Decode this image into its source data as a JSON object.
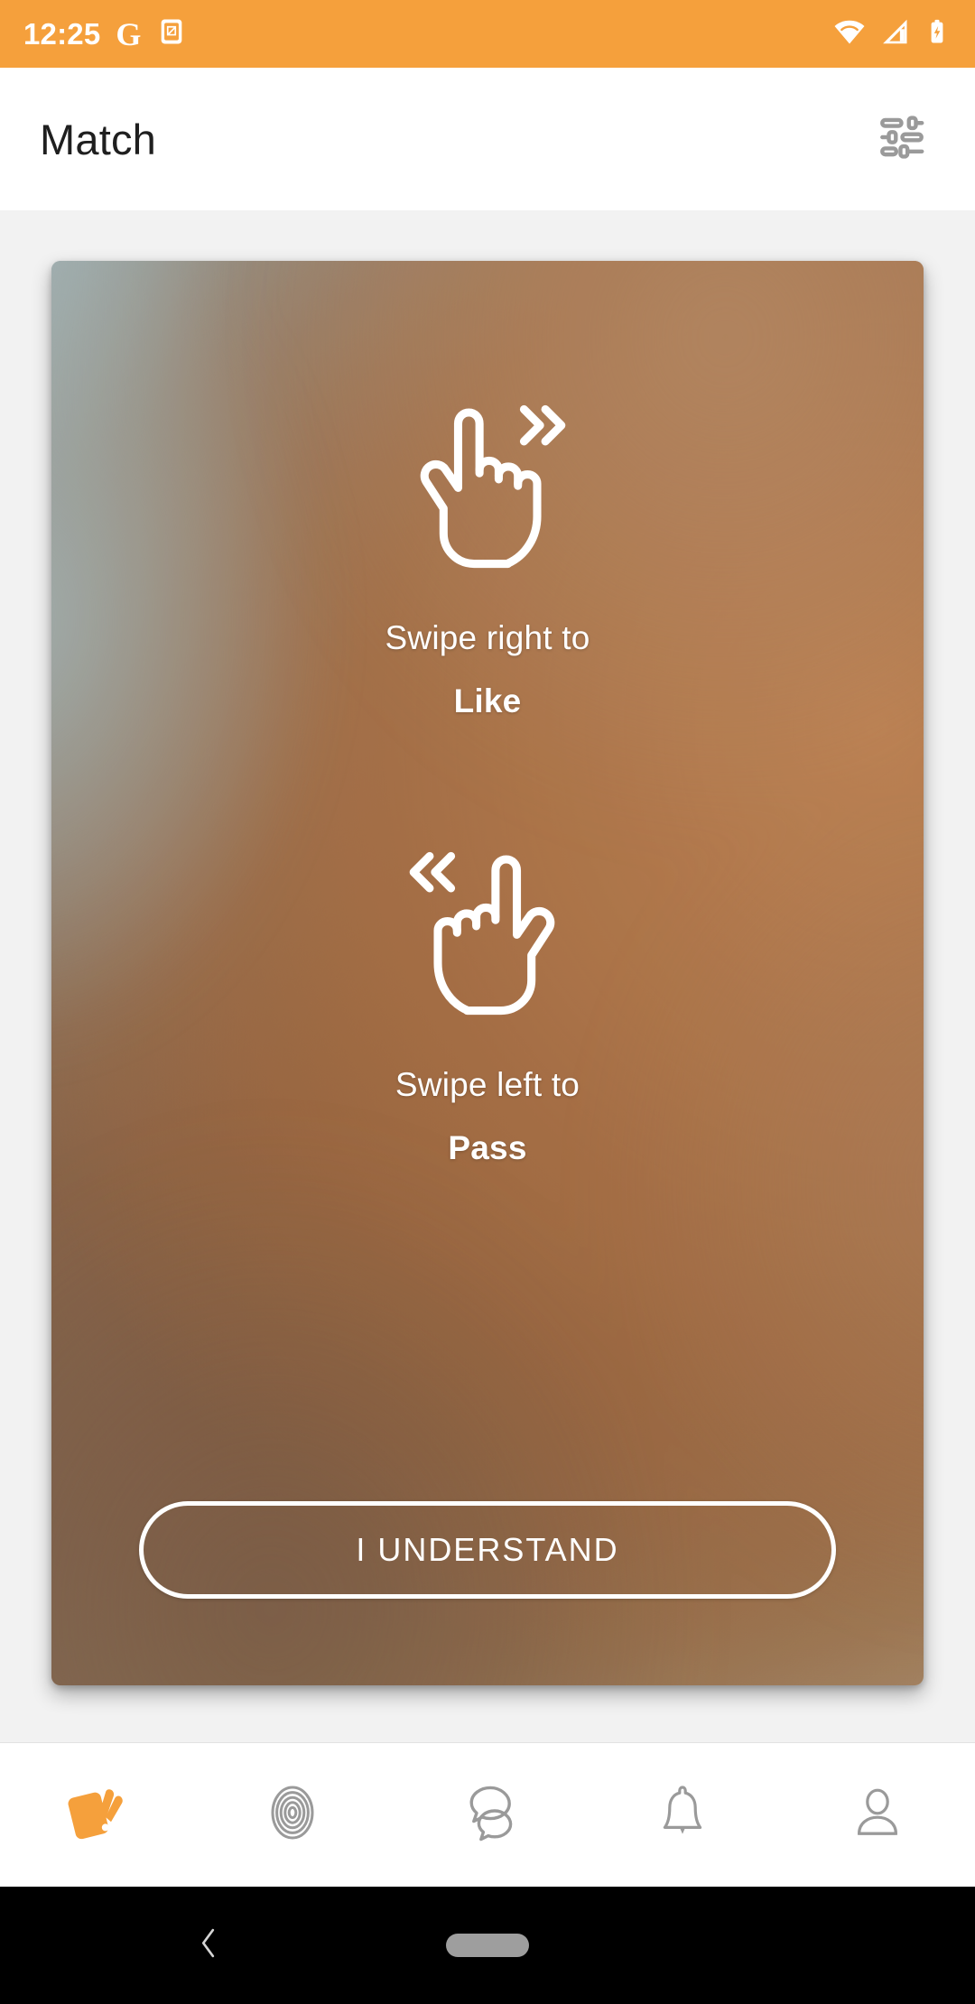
{
  "status_bar": {
    "time": "12:25",
    "background_color": "#F5A03C",
    "icons": [
      "google-icon",
      "screenshot-icon",
      "wifi-icon",
      "cellular-signal-icon",
      "battery-charging-icon"
    ]
  },
  "app_bar": {
    "title": "Match",
    "filter_icon": "tune-filter-icon"
  },
  "card": {
    "gestures": [
      {
        "icon": "swipe-right-hand-icon",
        "caption": "Swipe right to",
        "action": "Like"
      },
      {
        "icon": "swipe-left-hand-icon",
        "caption": "Swipe left to",
        "action": "Pass"
      }
    ],
    "confirm_button": "I UNDERSTAND"
  },
  "bottom_nav": {
    "items": [
      {
        "name": "cards",
        "icon": "cards-stack-icon",
        "active": true
      },
      {
        "name": "radar",
        "icon": "concentric-circles-icon",
        "active": false
      },
      {
        "name": "chat",
        "icon": "chat-bubbles-icon",
        "active": false
      },
      {
        "name": "notifications",
        "icon": "bell-icon",
        "active": false
      },
      {
        "name": "profile",
        "icon": "person-icon",
        "active": false
      }
    ],
    "active_color": "#F5A03C",
    "inactive_color": "#9a9a9a"
  },
  "system_nav": {
    "back_icon": "chevron-left-icon",
    "home_icon": "home-pill-icon"
  }
}
